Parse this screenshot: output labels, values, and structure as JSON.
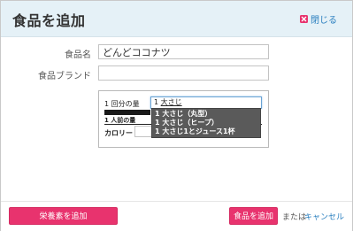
{
  "dialog": {
    "title": "食品を追加",
    "close_label": "閉じる",
    "close_icon": "close-icon",
    "accent_color": "#e8336e"
  },
  "form": {
    "food_name_label": "食品名",
    "food_name_value": "どんどココナツ",
    "brand_label": "食品ブランド",
    "brand_value": ""
  },
  "serving": {
    "label": "1 回分の量",
    "input_prefix": "1 ",
    "input_underlined": "大さじ",
    "per_person_label": "1 人前の量",
    "calorie_label": "カロリー",
    "calorie_value": "",
    "suggestions": [
      "1 大さじ（丸型）",
      "1 大さじ（ヒープ）",
      "1 大さじ1とジュース1杯"
    ]
  },
  "footer": {
    "add_nutrition_label": "栄養素を追加",
    "add_food_label": "食品を追加",
    "or_label": "または",
    "cancel_label": "キャンセル"
  }
}
